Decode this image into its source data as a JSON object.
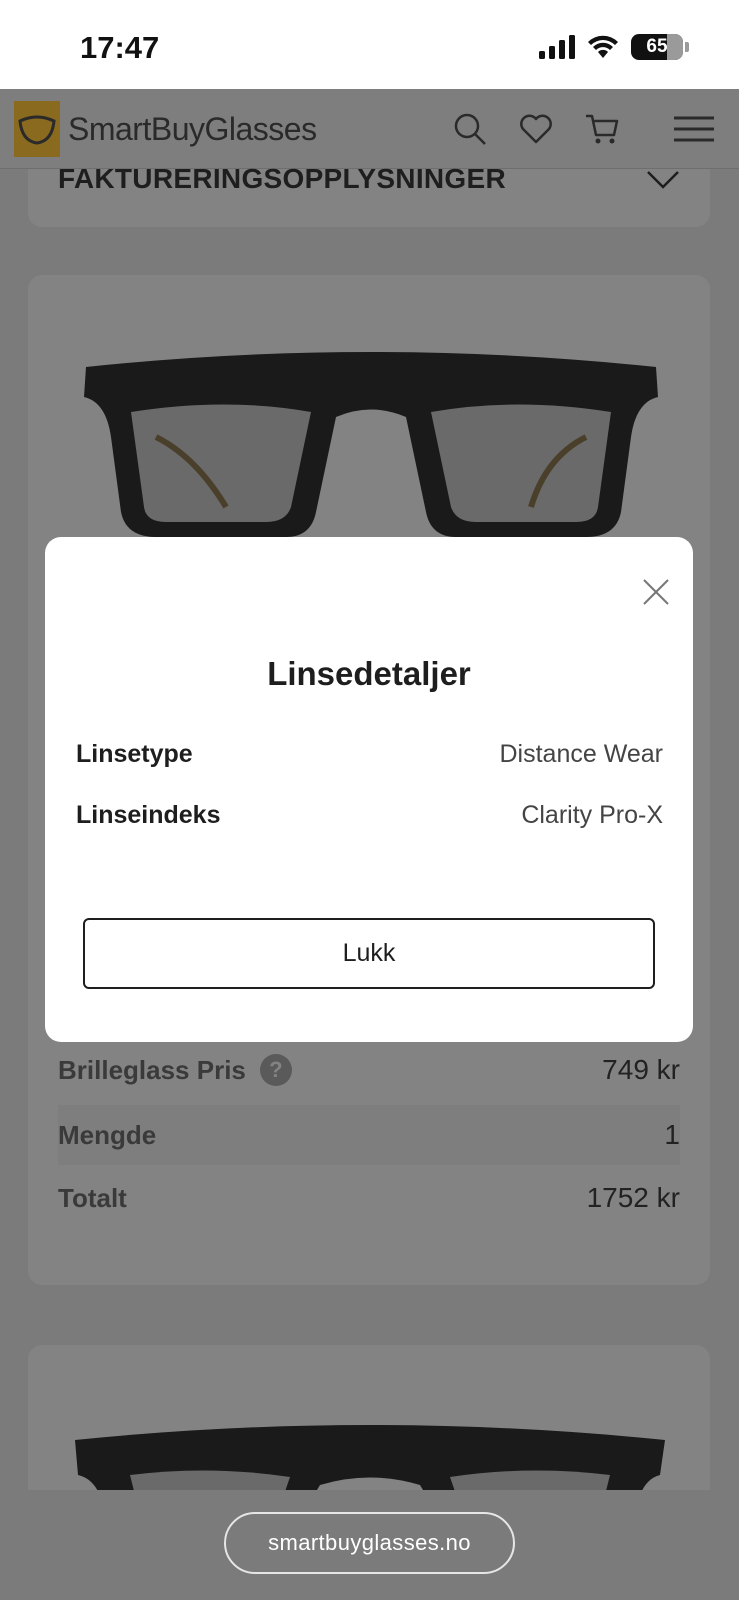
{
  "status_bar": {
    "time": "17:47",
    "battery": "65"
  },
  "header": {
    "logo_text": "SmartBuyGlasses",
    "icons": [
      "search-icon",
      "heart-icon",
      "cart-icon",
      "menu-icon"
    ]
  },
  "billing": {
    "title": "FAKTURERINGSOPPLYSNINGER"
  },
  "product": {
    "rows": [
      {
        "label": "Brilleglass Pris",
        "value": "749 kr"
      },
      {
        "label": "Mengde",
        "value": "1"
      },
      {
        "label": "Totalt",
        "value": "1752 kr"
      }
    ]
  },
  "modal": {
    "title": "Linsedetaljer",
    "details": [
      {
        "label": "Linsetype",
        "value": "Distance Wear"
      },
      {
        "label": "Linseindeks",
        "value": "Clarity Pro-X"
      }
    ],
    "close_button": "Lukk"
  },
  "url_bar": {
    "url": "smartbuyglasses.no"
  },
  "colors": {
    "overlay": "#7b7b7b",
    "modal_bg": "#ffffff",
    "text": "#1e1e1e"
  }
}
